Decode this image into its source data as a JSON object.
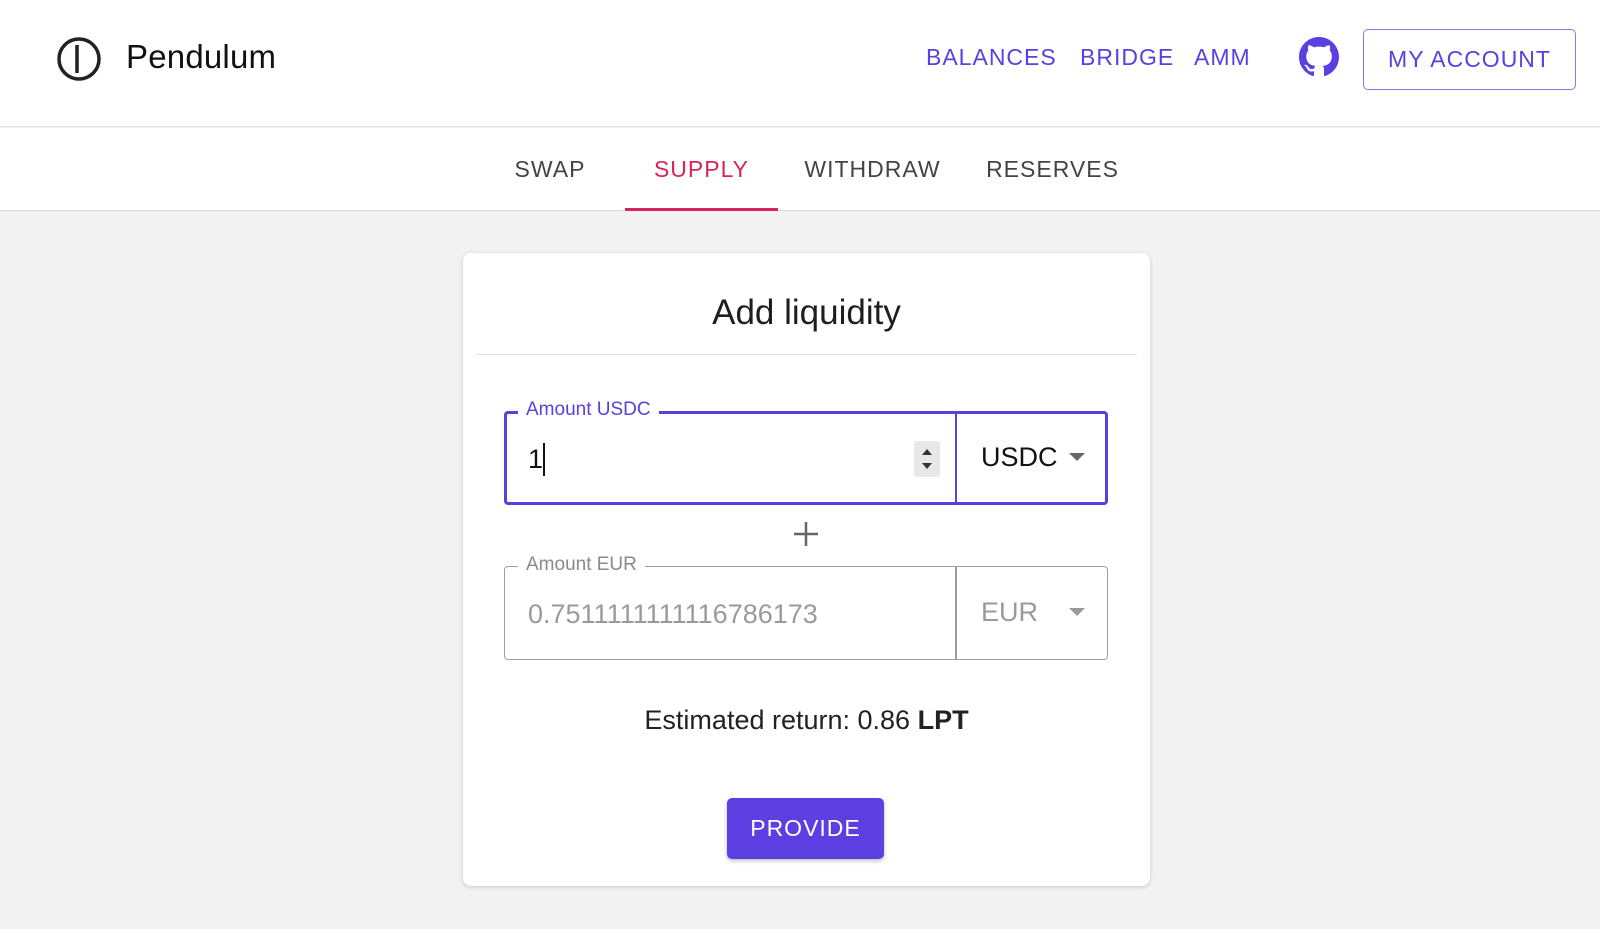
{
  "header": {
    "brand": "Pendulum",
    "nav": {
      "balances": "BALANCES",
      "bridge": "BRIDGE",
      "amm": "AMM"
    },
    "account_button": "MY ACCOUNT",
    "icons": [
      "pendulum-logo-icon",
      "github-icon"
    ]
  },
  "tabs": {
    "items": [
      "SWAP",
      "SUPPLY",
      "WITHDRAW",
      "RESERVES"
    ],
    "active": "SUPPLY"
  },
  "card": {
    "title": "Add liquidity",
    "usdc_field": {
      "label": "Amount USDC",
      "value": "1",
      "asset": "USDC"
    },
    "eur_field": {
      "label": "Amount EUR",
      "value": "0.7511111111116786173",
      "asset": "EUR"
    },
    "estimate": {
      "prefix": "Estimated return: 0.86",
      "unit": "LPT"
    },
    "provide_button": "PROVIDE"
  },
  "colors": {
    "accent": "#5b3fe0",
    "active_tab": "#d8245a",
    "background": "#f2f2f2"
  }
}
